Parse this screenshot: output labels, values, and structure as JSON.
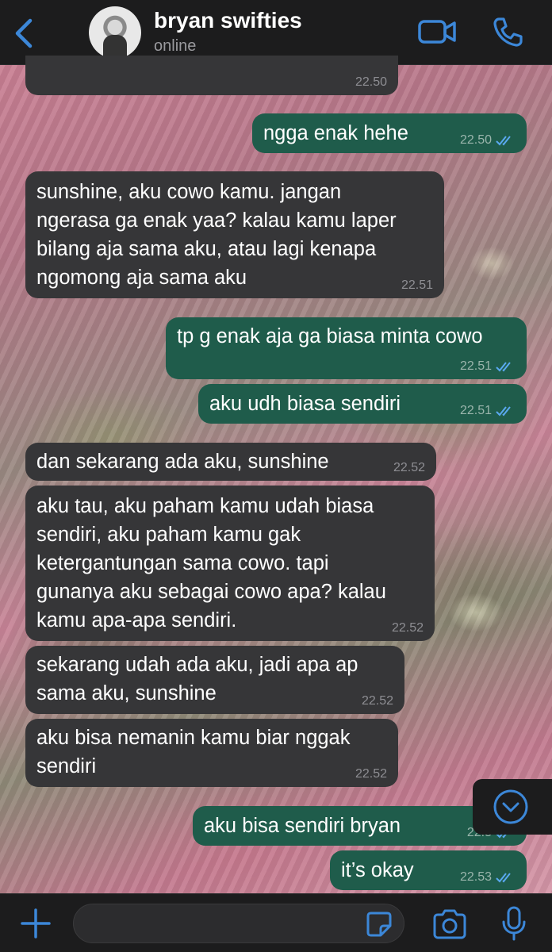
{
  "header": {
    "contact_name": "bryan swifties",
    "status": "online"
  },
  "colors": {
    "accent": "#3c87d8",
    "incoming_bubble": "#363638",
    "outgoing_bubble": "#1f5c4b",
    "bar_background": "#1c1c1d"
  },
  "messages": [
    {
      "direction": "in",
      "text": "",
      "time": "22.50"
    },
    {
      "direction": "out",
      "text": "ngga enak hehe",
      "time": "22.50",
      "read": true
    },
    {
      "direction": "in",
      "text": "sunshine, aku cowo kamu. jangan\nngerasa ga enak yaa? kalau kamu laper\nbilang aja sama aku, atau lagi kenapa\nngomong aja sama aku",
      "time": "22.51"
    },
    {
      "direction": "out",
      "text": "tp g enak aja ga biasa minta cowo",
      "time": "22.51",
      "read": true
    },
    {
      "direction": "out",
      "text": "aku udh biasa sendiri",
      "time": "22.51",
      "read": true
    },
    {
      "direction": "in",
      "text": "dan sekarang ada aku, sunshine",
      "time": "22.52"
    },
    {
      "direction": "in",
      "text": "aku tau, aku paham kamu udah biasa\nsendiri, aku paham kamu gak\nketergantungan sama cowo. tapi\ngunanya aku sebagai cowo apa? kalau\nkamu apa-apa sendiri.",
      "time": "22.52"
    },
    {
      "direction": "in",
      "text": "sekarang udah ada aku, jadi apa ap\nsama aku, sunshine",
      "time": "22.52"
    },
    {
      "direction": "in",
      "text": "aku bisa nemanin kamu biar nggak\nsendiri",
      "time": "22.52"
    },
    {
      "direction": "out",
      "text": "aku bisa sendiri bryan",
      "time": "22.5",
      "read": true
    },
    {
      "direction": "out",
      "text": "it’s okay",
      "time": "22.53",
      "read": true
    }
  ],
  "composer": {
    "value": "",
    "placeholder": ""
  },
  "icons": {
    "back": "chevron-left-icon",
    "video": "video-camera-icon",
    "call": "phone-icon",
    "scroll": "chevron-down-circle-icon",
    "attach": "plus-icon",
    "sticker": "sticker-icon",
    "camera": "camera-icon",
    "mic": "microphone-icon",
    "read_receipt": "double-check-icon"
  }
}
